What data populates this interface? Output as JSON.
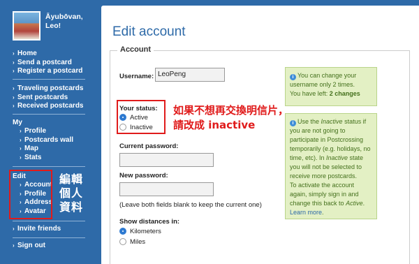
{
  "user": {
    "name": "Āyubōvan, Leo!"
  },
  "sidebar": {
    "group1": [
      "Home",
      "Send a postcard",
      "Register a postcard"
    ],
    "group2": [
      "Traveling postcards",
      "Sent postcards",
      "Received postcards"
    ],
    "my": {
      "heading": "My",
      "items": [
        "Profile",
        "Postcards wall",
        "Map",
        "Stats"
      ]
    },
    "edit": {
      "heading": "Edit",
      "items": [
        "Account",
        "Profile",
        "Address",
        "Avatar"
      ]
    },
    "invite": "Invite friends",
    "signout": "Sign out"
  },
  "annotations": {
    "edit_note": "編輯個人資料",
    "status_note_line1": "如果不想再交換明信片，",
    "status_note_line2": "請改成 inactive",
    "box_color": "#e01b1b"
  },
  "form": {
    "page_title": "Edit account",
    "legend": "Account",
    "username_label": "Username:",
    "username_value": "LeoPeng",
    "status_label": "Your status:",
    "status_options": [
      "Active",
      "Inactive"
    ],
    "status_selected": "Active",
    "current_password_label": "Current password:",
    "new_password_label": "New password:",
    "blank_note": "(Leave both fields blank to keep the current one)",
    "distances_label": "Show distances in:",
    "distance_options": [
      "Kilometers",
      "Miles"
    ],
    "distance_selected": "Kilometers"
  },
  "info": {
    "username_text": "You can change your username only 2 times.",
    "username_left_prefix": "You have left: ",
    "username_left_value": "2 changes",
    "status_1": "Use the ",
    "status_italic_1": "Inactive",
    "status_2": " status if you are not going to participate in Postcrossing temporarily (e.g. holidays, no time, etc). In ",
    "status_italic_2": "Inactive",
    "status_3": " state you will not be selected to receive more postcards.",
    "status_4": "To activate the account again, simply sign in and change this back to ",
    "status_italic_3": "Active",
    "status_5": ". ",
    "learn_more": "Learn more",
    "status_6": "."
  },
  "colors": {
    "brand_blue": "#2e6aa8",
    "info_bg": "#e3f0c4",
    "info_text": "#44701c"
  }
}
